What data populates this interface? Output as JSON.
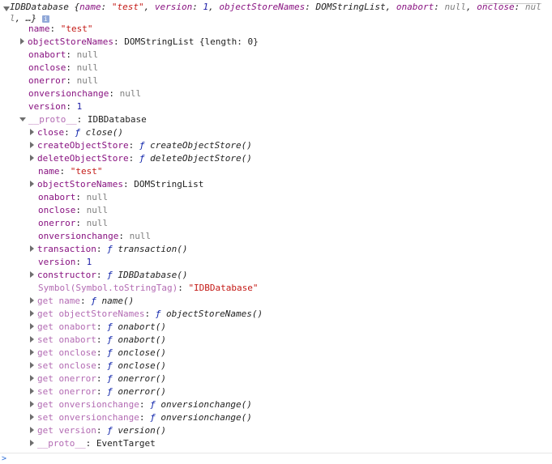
{
  "header": {
    "text_a": "IDBDatabase {",
    "k1": "name",
    "v1": "\"test\"",
    "k2": "version",
    "v2": "1",
    "k3": "objectStoreNames",
    "v3": "DOMStringList",
    "k4": "onabort",
    "v4": "null",
    "k5": "onclose",
    "v5": "nu",
    "wrap": "ll",
    "tail": ", …}",
    "info": "i"
  },
  "rows": {
    "r1": {
      "k": "name",
      "v": "\"test\""
    },
    "r2": {
      "k": "objectStoreNames",
      "v": "DOMStringList {length: 0}"
    },
    "r3": {
      "k": "onabort",
      "v": "null"
    },
    "r4": {
      "k": "onclose",
      "v": "null"
    },
    "r5": {
      "k": "onerror",
      "v": "null"
    },
    "r6": {
      "k": "onversionchange",
      "v": "null"
    },
    "r7": {
      "k": "version",
      "v": "1"
    },
    "r8": {
      "k": "__proto__",
      "v": "IDBDatabase"
    },
    "p1": {
      "k": "close",
      "f": "ƒ",
      "v": "close()"
    },
    "p2": {
      "k": "createObjectStore",
      "f": "ƒ",
      "v": "createObjectStore()"
    },
    "p3": {
      "k": "deleteObjectStore",
      "f": "ƒ",
      "v": "deleteObjectStore()"
    },
    "p4": {
      "k": "name",
      "v": "\"test\""
    },
    "p5": {
      "k": "objectStoreNames",
      "v": "DOMStringList"
    },
    "p6": {
      "k": "onabort",
      "v": "null"
    },
    "p7": {
      "k": "onclose",
      "v": "null"
    },
    "p8": {
      "k": "onerror",
      "v": "null"
    },
    "p9": {
      "k": "onversionchange",
      "v": "null"
    },
    "p10": {
      "k": "transaction",
      "f": "ƒ",
      "v": "transaction()"
    },
    "p11": {
      "k": "version",
      "v": "1"
    },
    "p12": {
      "k": "constructor",
      "f": "ƒ",
      "v": "IDBDatabase()"
    },
    "p13": {
      "k": "Symbol(Symbol.toStringTag)",
      "v": "\"IDBDatabase\""
    },
    "p14": {
      "k": "get name",
      "f": "ƒ",
      "v": "name()"
    },
    "p15": {
      "k": "get objectStoreNames",
      "f": "ƒ",
      "v": "objectStoreNames()"
    },
    "p16": {
      "k": "get onabort",
      "f": "ƒ",
      "v": "onabort()"
    },
    "p17": {
      "k": "set onabort",
      "f": "ƒ",
      "v": "onabort()"
    },
    "p18": {
      "k": "get onclose",
      "f": "ƒ",
      "v": "onclose()"
    },
    "p19": {
      "k": "set onclose",
      "f": "ƒ",
      "v": "onclose()"
    },
    "p20": {
      "k": "get onerror",
      "f": "ƒ",
      "v": "onerror()"
    },
    "p21": {
      "k": "set onerror",
      "f": "ƒ",
      "v": "onerror()"
    },
    "p22": {
      "k": "get onversionchange",
      "f": "ƒ",
      "v": "onversionchange()"
    },
    "p23": {
      "k": "set onversionchange",
      "f": "ƒ",
      "v": "onversionchange()"
    },
    "p24": {
      "k": "get version",
      "f": "ƒ",
      "v": "version()"
    },
    "p25": {
      "k": "__proto__",
      "v": "EventTarget"
    }
  },
  "prompt": ">"
}
